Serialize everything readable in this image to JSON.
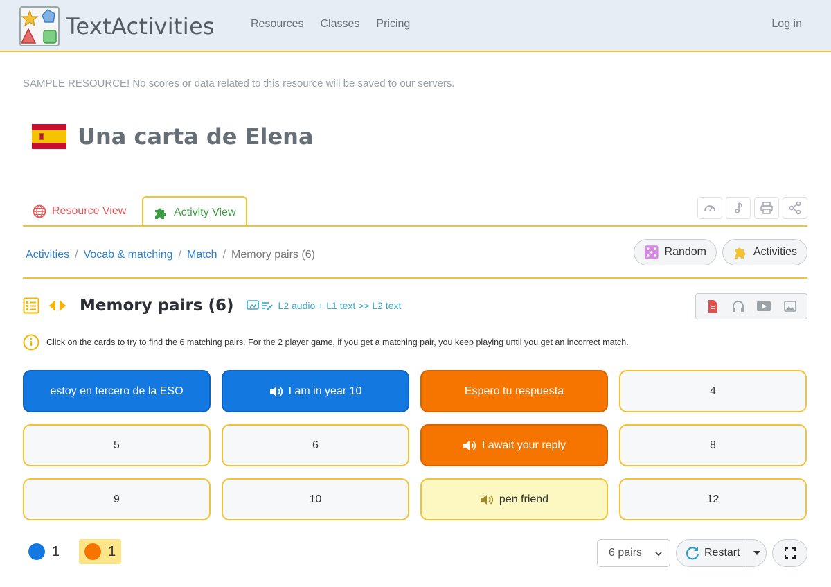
{
  "navbar": {
    "brand": "TextActivities",
    "links": [
      "Resources",
      "Classes",
      "Pricing"
    ],
    "login": "Log in"
  },
  "notice": "SAMPLE RESOURCE! No scores or data related to this resource will be saved to our servers.",
  "resource": {
    "title": "Una carta de Elena",
    "flag": "spain-flag"
  },
  "tabs": {
    "resource_view": "Resource View",
    "activity_view": "Activity View",
    "active": "activity_view"
  },
  "toolbar_icons": [
    "speedometer-icon",
    "music-note-icon",
    "printer-icon",
    "share-icon"
  ],
  "breadcrumb": {
    "items": [
      "Activities",
      "Vocab & matching",
      "Match"
    ],
    "current": "Memory pairs (6)"
  },
  "buttons": {
    "random": "Random",
    "activities": "Activities"
  },
  "activity": {
    "title": "Memory pairs (6)",
    "mode": "L2 audio + L1 text >> L2 text",
    "instructions": "Click on the cards to try to find the 6 matching pairs. For the 2 player game, if you get a matching pair, you keep playing until you get an incorrect match."
  },
  "media_icons": [
    "document-icon",
    "headphones-icon",
    "video-icon",
    "image-icon"
  ],
  "cards": [
    {
      "text": "estoy en tercero de la ESO",
      "state": "blue",
      "audio": false
    },
    {
      "text": "I am in year 10",
      "state": "blue",
      "audio": true
    },
    {
      "text": "Espero tu respuesta",
      "state": "orange",
      "audio": false
    },
    {
      "text": "4",
      "state": "hidden",
      "audio": false
    },
    {
      "text": "5",
      "state": "hidden",
      "audio": false
    },
    {
      "text": "6",
      "state": "hidden",
      "audio": false
    },
    {
      "text": "I await your reply",
      "state": "orange",
      "audio": true
    },
    {
      "text": "8",
      "state": "hidden",
      "audio": false
    },
    {
      "text": "9",
      "state": "hidden",
      "audio": false
    },
    {
      "text": "10",
      "state": "hidden",
      "audio": false
    },
    {
      "text": "pen friend",
      "state": "yellow",
      "audio": true
    },
    {
      "text": "12",
      "state": "hidden",
      "audio": false
    }
  ],
  "players": [
    {
      "color": "#1378e0",
      "score": "1",
      "active": false
    },
    {
      "color": "#f57500",
      "score": "1",
      "active": true
    }
  ],
  "controls": {
    "pairs_select": "6 pairs",
    "restart": "Restart"
  }
}
